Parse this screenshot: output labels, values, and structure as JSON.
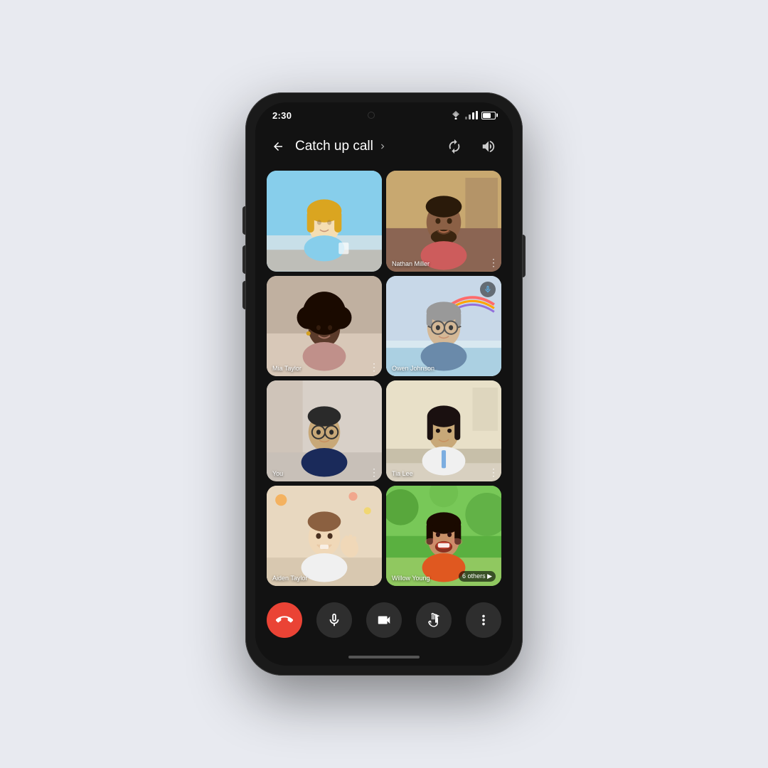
{
  "phone": {
    "status_bar": {
      "time": "2:30",
      "camera_dot": true
    },
    "header": {
      "back_label": "←",
      "title": "Catch up call",
      "chevron": "▶",
      "icon_rotate": "↻",
      "icon_audio": "🔊"
    },
    "participants": [
      {
        "id": 1,
        "name": "",
        "bg_class": "bg-1",
        "position": "top-left",
        "has_more": false,
        "has_audio_indicator": false
      },
      {
        "id": 2,
        "name": "Nathan Miller",
        "bg_class": "bg-2",
        "position": "top-right",
        "has_more": true,
        "has_audio_indicator": false
      },
      {
        "id": 3,
        "name": "Mia Taylor",
        "bg_class": "bg-3",
        "position": "mid1-left",
        "has_more": true,
        "has_audio_indicator": false
      },
      {
        "id": 4,
        "name": "Owen Johnson",
        "bg_class": "bg-4",
        "position": "mid1-right",
        "has_more": false,
        "has_audio_indicator": true
      },
      {
        "id": 5,
        "name": "You",
        "bg_class": "bg-5",
        "position": "mid2-left",
        "has_more": true,
        "has_audio_indicator": false
      },
      {
        "id": 6,
        "name": "Tia Lee",
        "bg_class": "bg-6",
        "position": "mid2-right",
        "has_more": true,
        "has_audio_indicator": false
      },
      {
        "id": 7,
        "name": "Aiden Taylor",
        "bg_class": "bg-7",
        "position": "bot-left",
        "has_more": false,
        "has_audio_indicator": false
      },
      {
        "id": 8,
        "name": "Willow Young",
        "bg_class": "bg-8",
        "position": "bot-right",
        "has_more": false,
        "has_audio_indicator": false,
        "others_count": "6 others"
      }
    ],
    "controls": [
      {
        "id": "end",
        "label": "📞",
        "type": "end",
        "aria": "end-call"
      },
      {
        "id": "mic",
        "label": "🎤",
        "type": "default",
        "aria": "mute-microphone"
      },
      {
        "id": "cam",
        "label": "📷",
        "type": "default",
        "aria": "toggle-camera"
      },
      {
        "id": "hand",
        "label": "✋",
        "type": "default",
        "aria": "raise-hand"
      },
      {
        "id": "more",
        "label": "⋮",
        "type": "default",
        "aria": "more-options"
      }
    ]
  }
}
